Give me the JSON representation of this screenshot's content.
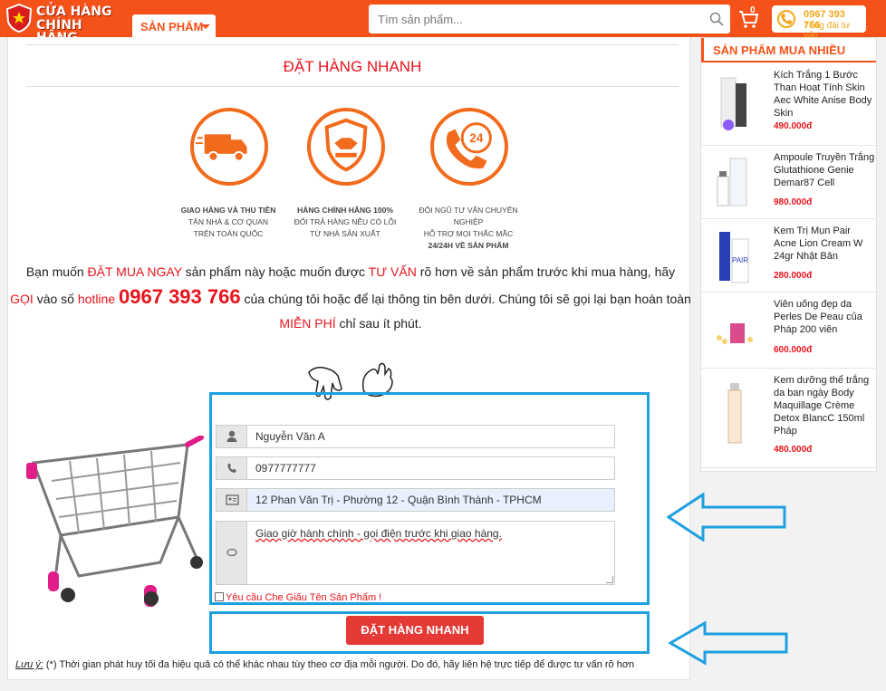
{
  "header": {
    "logo_line1": "CỬA HÀNG",
    "logo_line2": "CHÍNH HÃNG",
    "menu_label": "SẢN PHẨM",
    "search_placeholder": "Tìm sản phẩm...",
    "cart_count": "0",
    "hotline_number": "0967 393 766",
    "hotline_label": "Tổng đài tư vấn",
    "accent": "#f5521a"
  },
  "main": {
    "title": "ĐẶT HÀNG NHANH",
    "features": [
      {
        "icon": "delivery-truck-icon",
        "line1": "GIAO HÀNG VÀ THU TIỀN",
        "line2": "TẬN NHÀ & CƠ QUAN",
        "line3": "TRÊN TOÀN QUỐC"
      },
      {
        "icon": "handshake-shield-icon",
        "line1": "HÀNG CHÍNH HÃNG 100%",
        "line2": "ĐỔI TRẢ HÀNG NẾU CÓ LỖI",
        "line3": "TỪ NHÀ SẢN XUẤT"
      },
      {
        "icon": "support-24h-icon",
        "line1": "ĐỘI NGŨ TƯ VẤN CHUYÊN NGHIỆP",
        "line2": "HỖ TRỢ MỌI THẮC MẮC",
        "line3": "24/24H VỀ SẢN PHẨM"
      }
    ],
    "intro": {
      "p1": "Bạn muốn ",
      "p2": "ĐẶT MUA NGAY",
      "p3": " sản phẩm này hoặc muốn được ",
      "p4": "TƯ VẤN",
      "p5": " rõ hơn về sản phẩm trước khi mua hàng, hãy ",
      "p6": "GỌI",
      "p7": " vào số ",
      "p8": "hotline",
      "p9": " ",
      "p10": "0967 393 766",
      "p11": " của chúng tôi hoặc để lại thông tin bên dưới. Chúng tôi sẽ gọi lại bạn hoàn toàn ",
      "p12": "MIỄN PHÍ",
      "p13": " chỉ sau ít phút."
    },
    "form": {
      "name_value": "Nguyễn Văn A",
      "phone_value": "0977777777",
      "address_value": "12 Phan Văn Trị - Phường 12 - Quận Bình Thành - TPHCM",
      "note_value": "Giao giờ hành chính - gọi điện trước khi giao hàng.",
      "checkbox_label": "Yêu cầu Che Giấu Tên Sản Phẩm !",
      "submit_label": "ĐẶT HÀNG NHANH"
    },
    "note_label": "Lưu ý:",
    "note_text": " (*) Thời gian phát huy tối đa hiệu quả có thể khác nhau tùy theo cơ địa mỗi người. Do đó, hãy liên hệ trực tiếp để được tư vấn rõ hơn"
  },
  "sidebar": {
    "title": "SẢN PHẨM MUA NHIỀU",
    "items": [
      {
        "name": "Kích Trắng 1 Bước Than Hoạt Tính Skin Aec White Anise Body Skin",
        "price": "490.000đ"
      },
      {
        "name": "Ampoule Truyền Trắng Glutathione Genie Demar87 Cell",
        "price": "980.000đ"
      },
      {
        "name": "Kem Trị Mụn Pair Acne Lion Cream W 24gr Nhật Bản",
        "price": "280.000đ"
      },
      {
        "name": "Viên uống đẹp da Perles De Peau của Pháp 200 viên",
        "price": "600.000đ"
      },
      {
        "name": "Kem dưỡng thể trắng da ban ngày Body Maquillage Crème Detox BlancC 150ml Pháp",
        "price": "480.000đ"
      }
    ]
  }
}
